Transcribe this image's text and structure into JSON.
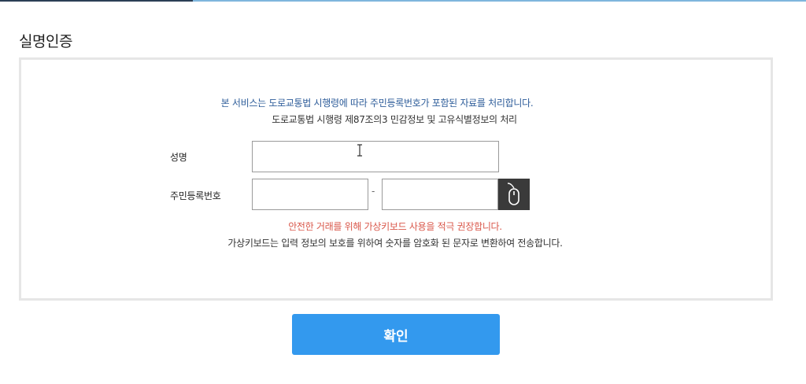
{
  "page": {
    "title": "실명인증"
  },
  "notice": {
    "line1": "본 서비스는 도로교통법 시행령에 따라 주민등록번호가 포함된 자료를 처리합니다.",
    "line2": "도로교통법 시행령 제87조의3 민감정보 및 고유식별정보의 처리"
  },
  "form": {
    "name_label": "성명",
    "name_value": "",
    "rrn_label": "주민등록번호",
    "rrn_front_value": "",
    "rrn_back_value": "",
    "rrn_separator": "-",
    "virtual_keyboard_icon": "mouse-icon"
  },
  "warning": {
    "line1": "안전한 거래를 위해 가상키보드 사용을 적극 권장합니다.",
    "line2": "가상키보드는 입력 정보의 보호를 위하여 숫자를 암호화 된 문자로 변환하여 전송합니다."
  },
  "actions": {
    "confirm_label": "확인"
  },
  "colors": {
    "accent": "#3399ee",
    "notice_blue": "#2e5d9a",
    "warning_red": "#d9574a",
    "keyboard_button": "#3a3a3a"
  }
}
